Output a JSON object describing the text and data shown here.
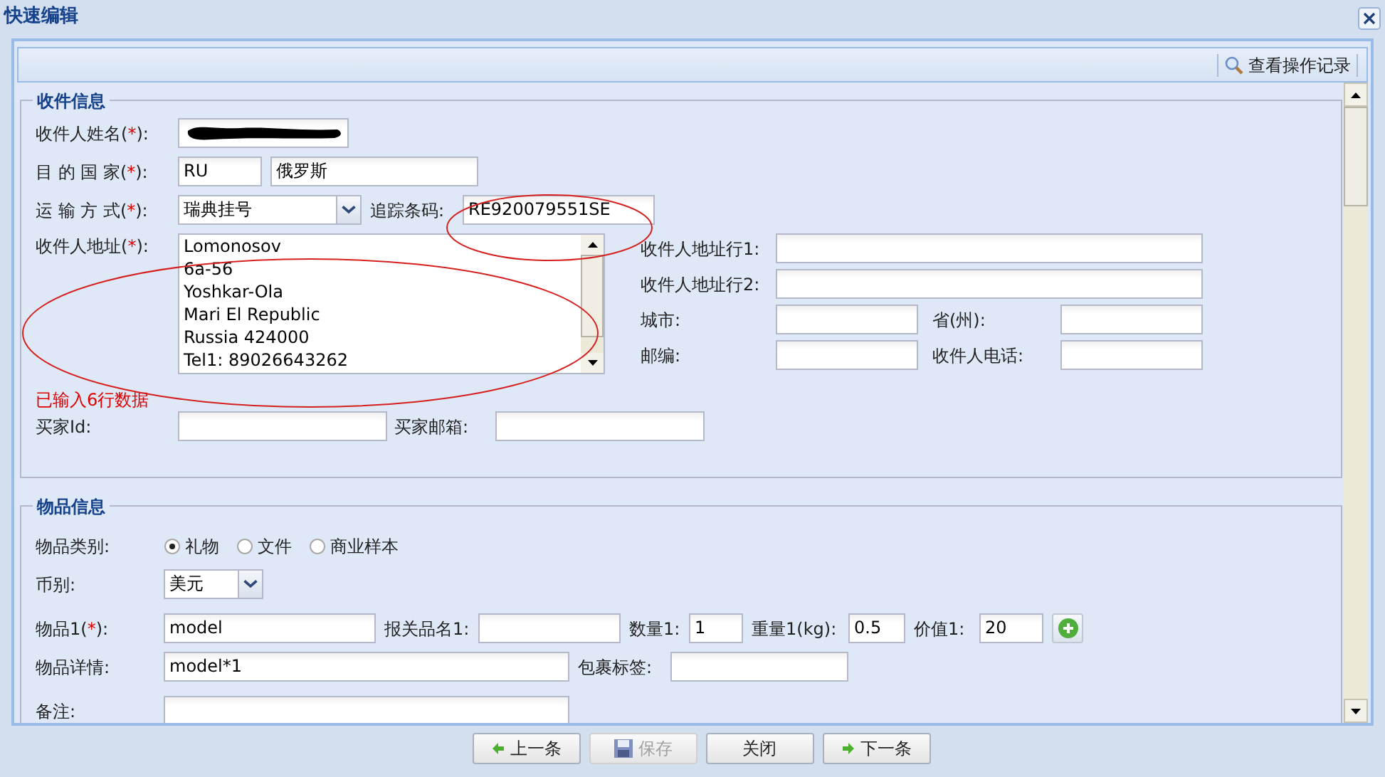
{
  "window": {
    "title": "快速编辑"
  },
  "toolbar": {
    "history_button": "查看操作记录"
  },
  "recipient_section": {
    "legend": "收件信息",
    "name": {
      "label_parts": [
        "收件人姓名(",
        "*",
        "):"
      ]
    },
    "country": {
      "label_parts": [
        "目 的 国 家(",
        "*",
        "):"
      ],
      "code": "RU",
      "name": "俄罗斯"
    },
    "shipping": {
      "label_parts": [
        "运 输 方 式(",
        "*",
        "):"
      ],
      "value": "瑞典挂号"
    },
    "tracking": {
      "label": "追踪条码:",
      "value": "RE920079551SE"
    },
    "address": {
      "label_parts": [
        "收件人地址(",
        "*",
        "):"
      ],
      "lines": [
        "Lomonosov",
        "6a-56",
        "Yoshkar-Ola",
        "Mari El Republic",
        "Russia 424000",
        "Tel1: 89026643262"
      ],
      "count_note": "已输入6行数据"
    },
    "address_lines": [
      {
        "label": "收件人地址行1:"
      },
      {
        "label": "收件人地址行2:"
      }
    ],
    "pairs": [
      [
        {
          "label": "城市:"
        },
        {
          "label": "省(州):"
        }
      ],
      [
        {
          "label": "邮编:"
        },
        {
          "label": "收件人电话:"
        }
      ]
    ],
    "buyer_id": {
      "label": "买家Id:"
    },
    "buyer_email": {
      "label": "买家邮箱:"
    }
  },
  "items_section": {
    "legend": "物品信息",
    "category": {
      "label": "物品类别:",
      "options": [
        {
          "label": "礼物",
          "selected": true
        },
        {
          "label": "文件",
          "selected": false
        },
        {
          "label": "商业样本",
          "selected": false
        }
      ]
    },
    "currency": {
      "label": "币别:",
      "value": "美元"
    },
    "item": {
      "label_parts": [
        "物品1(",
        "*",
        "):"
      ],
      "value": "model"
    },
    "customs_name": {
      "label": "报关品名1:"
    },
    "quantity": {
      "label": "数量1:",
      "value": "1"
    },
    "weight": {
      "label": "重量1(kg):",
      "value": "0.5"
    },
    "price": {
      "label": "价值1:",
      "value": "20"
    },
    "details": {
      "label": "物品详情:",
      "value": "model*1"
    },
    "package_tag": {
      "label": "包裹标签:"
    },
    "remark": {
      "label": "备注:"
    }
  },
  "footer_buttons": [
    {
      "label": "上一条",
      "kind": "prev",
      "disabled": false
    },
    {
      "label": "保存",
      "kind": "save",
      "disabled": true
    },
    {
      "label": "关闭",
      "kind": "close",
      "disabled": false
    },
    {
      "label": "下一条",
      "kind": "next",
      "disabled": false
    }
  ]
}
